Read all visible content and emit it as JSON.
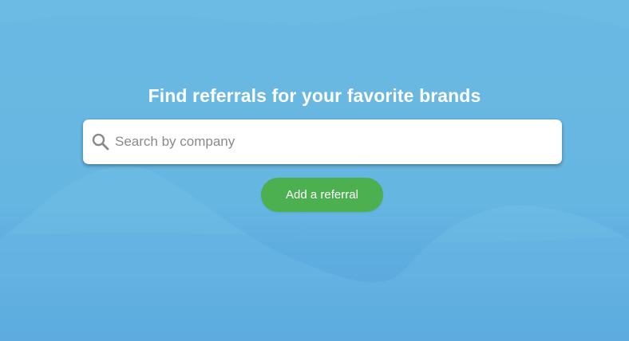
{
  "hero": {
    "title": "Find referrals for your favorite brands",
    "search": {
      "placeholder": "Search by company",
      "value": "",
      "icon": "search-icon"
    },
    "add_button_label": "Add a referral"
  },
  "colors": {
    "background_top": "#69b9e3",
    "background_bottom": "#4690d7",
    "accent_button": "#4caf50",
    "title_text": "#ffffff",
    "placeholder_text": "#8a8a8a",
    "icon": "#8a8a8a"
  }
}
